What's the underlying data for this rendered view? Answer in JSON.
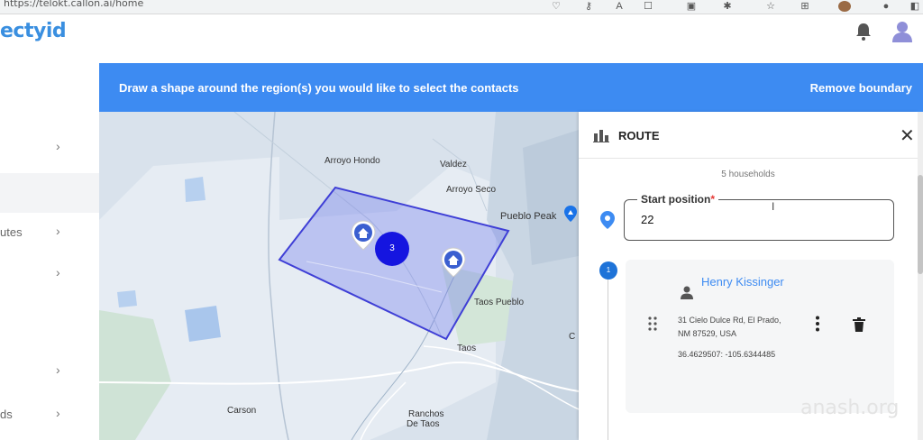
{
  "browser": {
    "url": "https://telokt.callon.ai/home"
  },
  "app": {
    "logo_text": "ectyid",
    "accent_color": "#3d8bf2"
  },
  "sidebar": {
    "items": [
      {
        "label": "",
        "icon": "chevron-right-icon"
      },
      {
        "label": "",
        "icon": ""
      },
      {
        "label": "utes",
        "icon": "chevron-right-icon"
      },
      {
        "label": "",
        "icon": "chevron-right-icon"
      },
      {
        "label": "",
        "icon": "chevron-right-icon"
      },
      {
        "label": "ds",
        "icon": "chevron-right-icon"
      }
    ]
  },
  "instruction_bar": {
    "text": "Draw a shape around the region(s) you would like to select the contacts",
    "remove_label": "Remove boundary"
  },
  "map": {
    "places": {
      "arroyo_hondo": "Arroyo Hondo",
      "valdez": "Valdez",
      "arroyo_seco": "Arroyo Seco",
      "pueblo_peak": "Pueblo Peak",
      "taos_pueblo": "Taos Pueblo",
      "taos": "Taos",
      "carson": "Carson",
      "ranchos_line1": "Ranchos",
      "ranchos_line2": "De Taos",
      "edge_c": "C"
    },
    "cluster_count": "3",
    "house_markers": [
      "home-marker-icon",
      "home-marker-icon"
    ],
    "selection_color": "#3f3fd6"
  },
  "panel": {
    "title": "ROUTE",
    "households": "5 households",
    "start_label": "Start position",
    "required_mark": "*",
    "start_value": "22",
    "stops": [
      {
        "index": "1",
        "name": "Henry Kissinger",
        "address": "31 Cielo Dulce Rd, El Prado, NM 87529, USA",
        "coordinates": "36.4629507: -105.6344485"
      }
    ]
  },
  "watermark": "anash.org"
}
